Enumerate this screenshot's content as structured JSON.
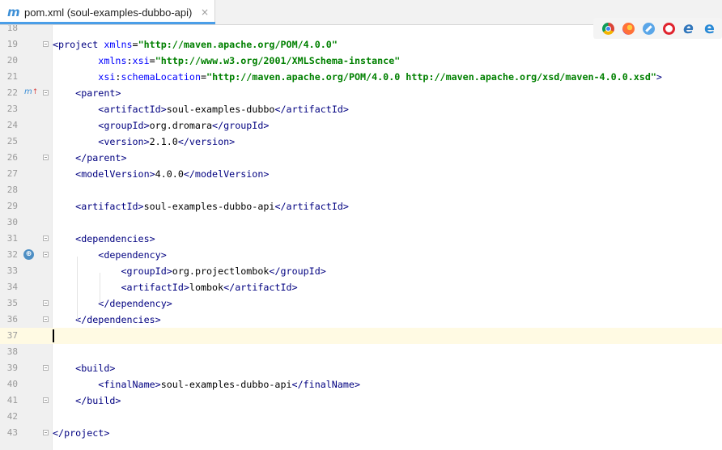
{
  "tab": {
    "icon": "m",
    "label": "pom.xml (soul-examples-dubbo-api)",
    "close": "×"
  },
  "gutter_icons": {
    "line22": "maven-override-icon",
    "line32": "dependency-icon"
  },
  "browser_icons": [
    "chrome-icon",
    "firefox-icon",
    "safari-icon",
    "opera-icon",
    "edge-icon",
    "ie-icon"
  ],
  "colors": {
    "tag": "#000080",
    "attribute": "#0000ff",
    "value": "#008000",
    "current_line": "#fffae3",
    "tab_underline": "#4a9ee8"
  },
  "editor": {
    "current_line": 37,
    "lines": [
      {
        "n": "18",
        "segs": []
      },
      {
        "n": "19",
        "segs": [
          {
            "c": "tag",
            "t": "<project "
          },
          {
            "c": "attr",
            "t": "xmlns"
          },
          {
            "c": "",
            "t": "="
          },
          {
            "c": "val",
            "t": "\"http://maven.apache.org/POM/4.0.0\""
          }
        ]
      },
      {
        "n": "20",
        "segs": [
          {
            "c": "",
            "t": "        "
          },
          {
            "c": "attr",
            "t": "xmlns"
          },
          {
            "c": "",
            "t": ":"
          },
          {
            "c": "attr",
            "t": "xsi"
          },
          {
            "c": "",
            "t": "="
          },
          {
            "c": "val",
            "t": "\"http://www.w3.org/2001/XMLSchema-instance\""
          }
        ]
      },
      {
        "n": "21",
        "segs": [
          {
            "c": "",
            "t": "        "
          },
          {
            "c": "attr",
            "t": "xsi"
          },
          {
            "c": "",
            "t": ":"
          },
          {
            "c": "attr",
            "t": "schemaLocation"
          },
          {
            "c": "",
            "t": "="
          },
          {
            "c": "val",
            "t": "\"http://maven.apache.org/POM/4.0.0 http://maven.apache.org/xsd/maven-4.0.0.xsd\""
          },
          {
            "c": "tag",
            "t": ">"
          }
        ]
      },
      {
        "n": "22",
        "segs": [
          {
            "c": "",
            "t": "    "
          },
          {
            "c": "tag",
            "t": "<parent>"
          }
        ]
      },
      {
        "n": "23",
        "segs": [
          {
            "c": "",
            "t": "        "
          },
          {
            "c": "tag",
            "t": "<artifactId>"
          },
          {
            "c": "",
            "t": "soul-examples-dubbo"
          },
          {
            "c": "tag",
            "t": "</artifactId>"
          }
        ]
      },
      {
        "n": "24",
        "segs": [
          {
            "c": "",
            "t": "        "
          },
          {
            "c": "tag",
            "t": "<groupId>"
          },
          {
            "c": "",
            "t": "org.dromara"
          },
          {
            "c": "tag",
            "t": "</groupId>"
          }
        ]
      },
      {
        "n": "25",
        "segs": [
          {
            "c": "",
            "t": "        "
          },
          {
            "c": "tag",
            "t": "<version>"
          },
          {
            "c": "",
            "t": "2.1.0"
          },
          {
            "c": "tag",
            "t": "</version>"
          }
        ]
      },
      {
        "n": "26",
        "segs": [
          {
            "c": "",
            "t": "    "
          },
          {
            "c": "tag",
            "t": "</parent>"
          }
        ]
      },
      {
        "n": "27",
        "segs": [
          {
            "c": "",
            "t": "    "
          },
          {
            "c": "tag",
            "t": "<modelVersion>"
          },
          {
            "c": "",
            "t": "4.0.0"
          },
          {
            "c": "tag",
            "t": "</modelVersion>"
          }
        ]
      },
      {
        "n": "28",
        "segs": []
      },
      {
        "n": "29",
        "segs": [
          {
            "c": "",
            "t": "    "
          },
          {
            "c": "tag",
            "t": "<artifactId>"
          },
          {
            "c": "",
            "t": "soul-examples-dubbo-api"
          },
          {
            "c": "tag",
            "t": "</artifactId>"
          }
        ]
      },
      {
        "n": "30",
        "segs": []
      },
      {
        "n": "31",
        "segs": [
          {
            "c": "",
            "t": "    "
          },
          {
            "c": "tag",
            "t": "<dependencies>"
          }
        ]
      },
      {
        "n": "32",
        "segs": [
          {
            "c": "",
            "t": "        "
          },
          {
            "c": "tag",
            "t": "<dependency>"
          }
        ]
      },
      {
        "n": "33",
        "segs": [
          {
            "c": "",
            "t": "            "
          },
          {
            "c": "tag",
            "t": "<groupId>"
          },
          {
            "c": "",
            "t": "org.projectlombok"
          },
          {
            "c": "tag",
            "t": "</groupId>"
          }
        ]
      },
      {
        "n": "34",
        "segs": [
          {
            "c": "",
            "t": "            "
          },
          {
            "c": "tag",
            "t": "<artifactId>"
          },
          {
            "c": "",
            "t": "lombok"
          },
          {
            "c": "tag",
            "t": "</artifactId>"
          }
        ]
      },
      {
        "n": "35",
        "segs": [
          {
            "c": "",
            "t": "        "
          },
          {
            "c": "tag",
            "t": "</dependency>"
          }
        ]
      },
      {
        "n": "36",
        "segs": [
          {
            "c": "",
            "t": "    "
          },
          {
            "c": "tag",
            "t": "</dependencies>"
          }
        ]
      },
      {
        "n": "37",
        "segs": []
      },
      {
        "n": "38",
        "segs": []
      },
      {
        "n": "39",
        "segs": [
          {
            "c": "",
            "t": "    "
          },
          {
            "c": "tag",
            "t": "<build>"
          }
        ]
      },
      {
        "n": "40",
        "segs": [
          {
            "c": "",
            "t": "        "
          },
          {
            "c": "tag",
            "t": "<finalName>"
          },
          {
            "c": "",
            "t": "soul-examples-dubbo-api"
          },
          {
            "c": "tag",
            "t": "</finalName>"
          }
        ]
      },
      {
        "n": "41",
        "segs": [
          {
            "c": "",
            "t": "    "
          },
          {
            "c": "tag",
            "t": "</build>"
          }
        ]
      },
      {
        "n": "42",
        "segs": []
      },
      {
        "n": "43",
        "segs": [
          {
            "c": "tag",
            "t": "</project>"
          }
        ]
      }
    ]
  }
}
